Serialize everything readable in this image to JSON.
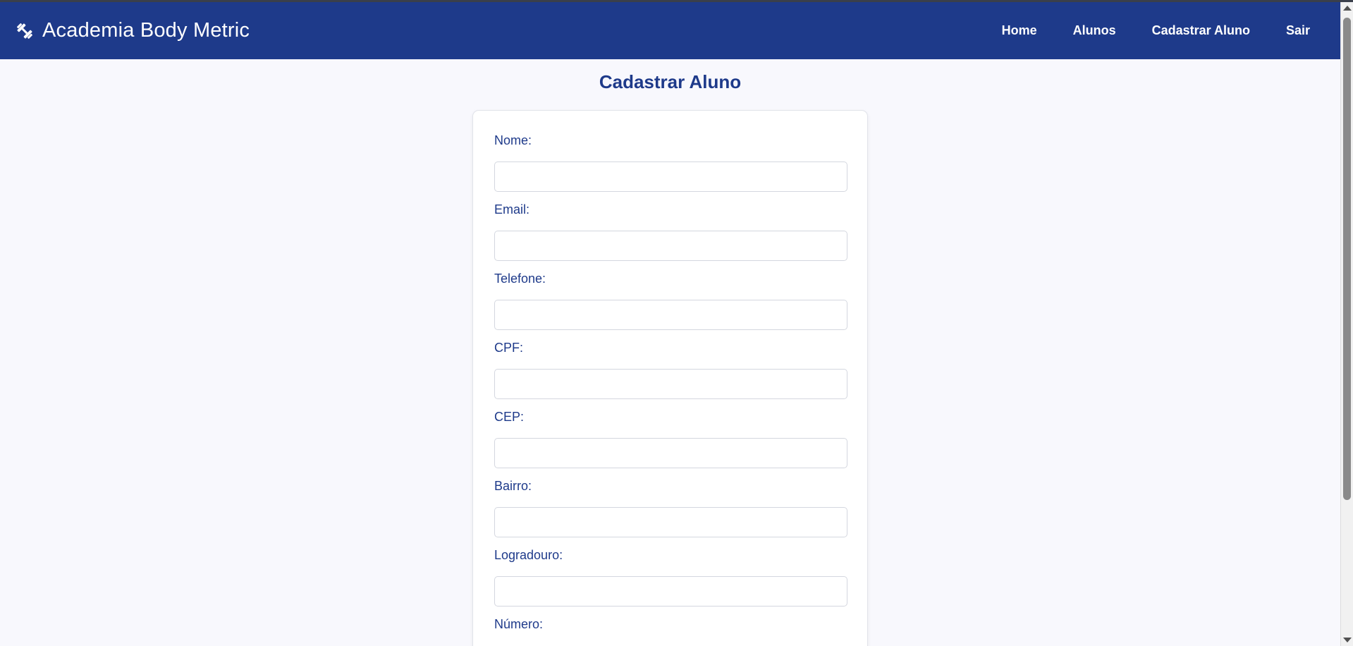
{
  "header": {
    "brand_icon": "dumbbell-icon",
    "brand_name": "Academia Body Metric",
    "background_color": "#1e3a8a",
    "nav": [
      {
        "label": "Home"
      },
      {
        "label": "Alunos"
      },
      {
        "label": "Cadastrar Aluno"
      },
      {
        "label": "Sair"
      }
    ]
  },
  "main": {
    "title": "Cadastrar Aluno",
    "form": {
      "fields": [
        {
          "label": "Nome:",
          "value": ""
        },
        {
          "label": "Email:",
          "value": ""
        },
        {
          "label": "Telefone:",
          "value": ""
        },
        {
          "label": "CPF:",
          "value": ""
        },
        {
          "label": "CEP:",
          "value": ""
        },
        {
          "label": "Bairro:",
          "value": ""
        },
        {
          "label": "Logradouro:",
          "value": ""
        },
        {
          "label": "Número:"
        }
      ]
    }
  },
  "colors": {
    "accent": "#1e3a8a",
    "page_background": "#f8f8fd",
    "card_background": "#ffffff"
  }
}
